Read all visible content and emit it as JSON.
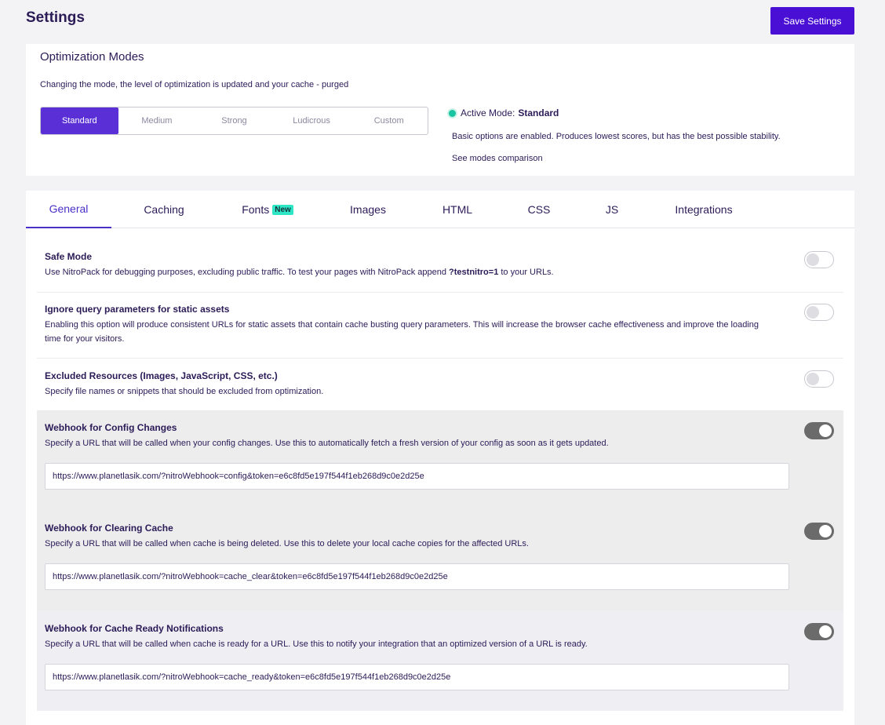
{
  "header": {
    "title": "Settings",
    "save_label": "Save Settings"
  },
  "modes": {
    "title": "Optimization Modes",
    "description": "Changing the mode, the level of optimization is updated and your cache - purged",
    "options": [
      "Standard",
      "Medium",
      "Strong",
      "Ludicrous",
      "Custom"
    ],
    "selected": "Standard",
    "active_label": "Active Mode:",
    "active_value": "Standard",
    "active_color": "#19c4a0",
    "info": "Basic options are enabled. Produces lowest scores, but has the best possible stability.",
    "compare_link": "See modes comparison"
  },
  "tabs": {
    "items": [
      "General",
      "Caching",
      "Fonts",
      "Images",
      "HTML",
      "CSS",
      "JS",
      "Integrations"
    ],
    "fonts_badge": "New",
    "active": "General"
  },
  "settings": {
    "safe_mode": {
      "title": "Safe Mode",
      "desc_pre": "Use NitroPack for debugging purposes, excluding public traffic. To test your pages with NitroPack append ",
      "desc_code": "?testnitro=1",
      "desc_post": " to your URLs.",
      "enabled": false
    },
    "ignore_query": {
      "title": "Ignore query parameters for static assets",
      "desc_line1": "Enabling this option will produce consistent URLs for static assets that contain cache busting query parameters. This will increase the browser cache effectiveness and improve the loading",
      "desc_line2": "time for your visitors.",
      "enabled": false
    },
    "excluded": {
      "title": "Excluded Resources (Images, JavaScript, CSS, etc.)",
      "desc": "Specify file names or snippets that should be excluded from optimization.",
      "enabled": false
    },
    "webhook_config": {
      "title": "Webhook for Config Changes",
      "desc": "Specify a URL that will be called when your config changes. Use this to automatically fetch a fresh version of your config as soon as it gets updated.",
      "url": "https://www.planetlasik.com/?nitroWebhook=config&token=e6c8fd5e197f544f1eb268d9c0e2d25e",
      "enabled": true
    },
    "webhook_cache_clear": {
      "title": "Webhook for Clearing Cache",
      "desc": "Specify a URL that will be called when cache is being deleted. Use this to delete your local cache copies for the affected URLs.",
      "url": "https://www.planetlasik.com/?nitroWebhook=cache_clear&token=e6c8fd5e197f544f1eb268d9c0e2d25e",
      "enabled": true
    },
    "webhook_cache_ready": {
      "title": "Webhook for Cache Ready Notifications",
      "desc": "Specify a URL that will be called when cache is ready for a URL. Use this to notify your integration that an optimized version of a URL is ready.",
      "url": "https://www.planetlasik.com/?nitroWebhook=cache_ready&token=e6c8fd5e197f544f1eb268d9c0e2d25e",
      "enabled": true
    }
  }
}
